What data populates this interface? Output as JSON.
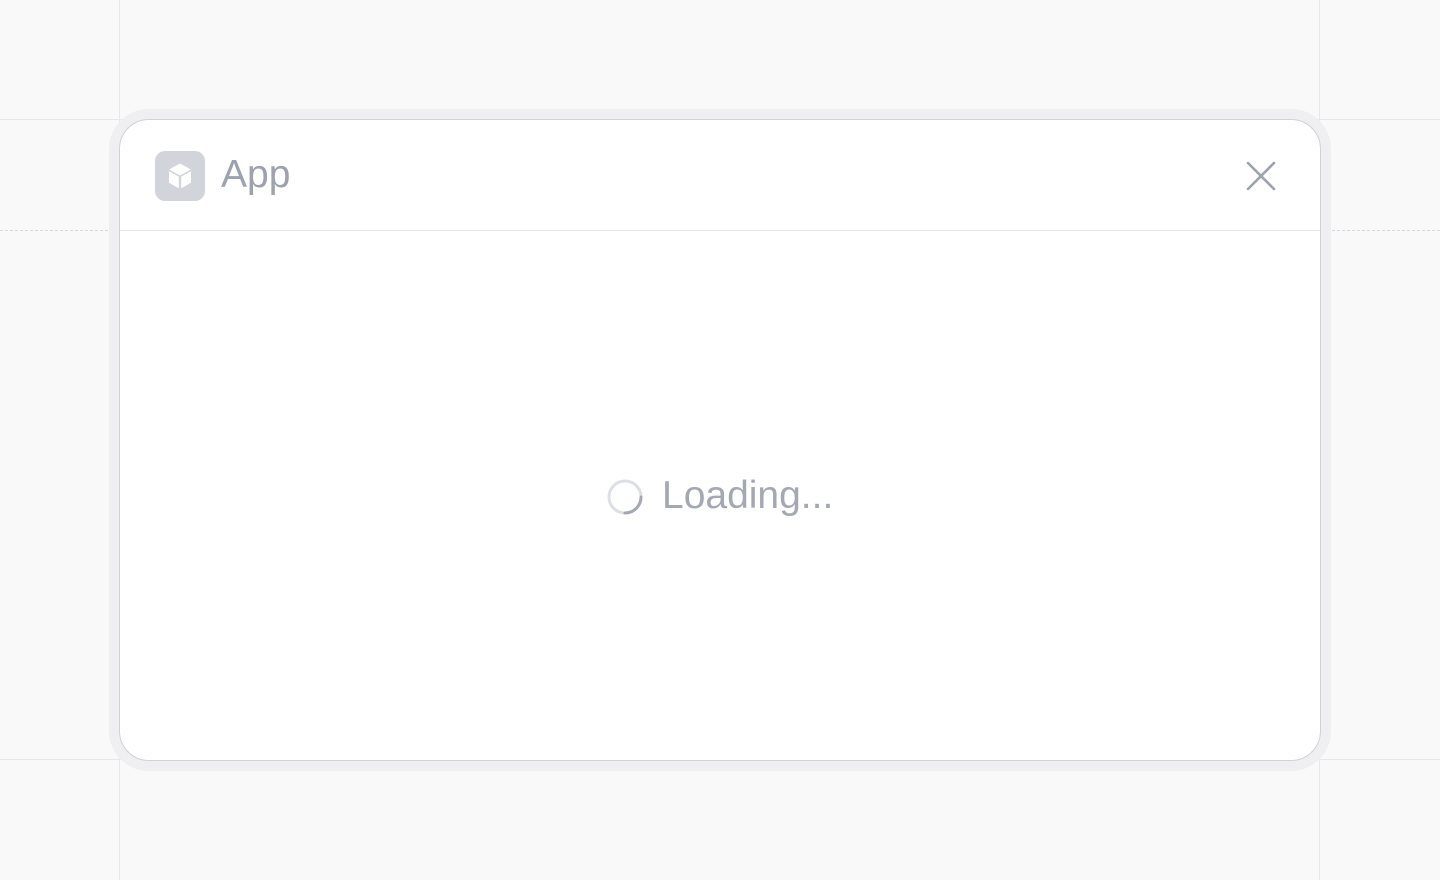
{
  "window": {
    "title": "App",
    "app_icon": "cube-icon",
    "close_icon": "close-icon"
  },
  "content": {
    "loading_text": "Loading...",
    "spinner_icon": "spinner-icon"
  },
  "colors": {
    "background": "#f9f9f9",
    "window": "#ffffff",
    "border": "#cfd2d7",
    "muted_text": "#9ca3af",
    "icon_tile": "#d1d5db"
  }
}
